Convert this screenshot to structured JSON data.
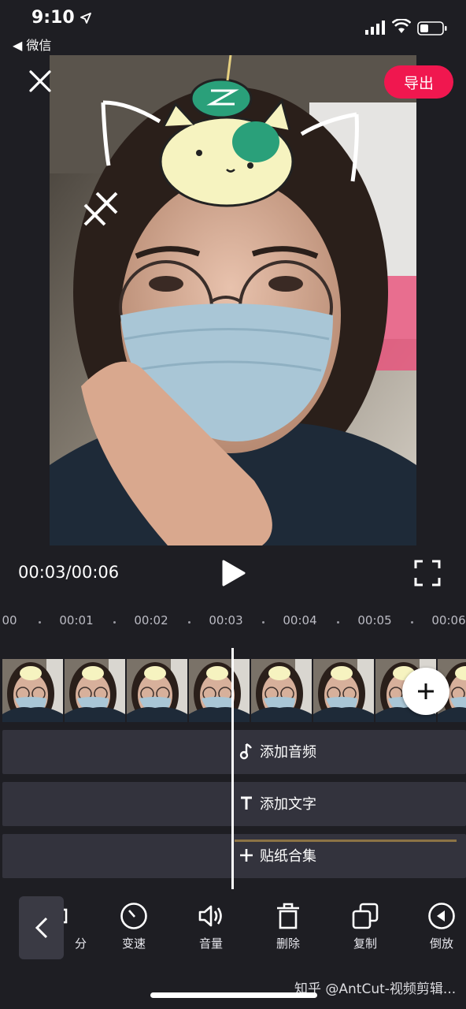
{
  "status_bar": {
    "time": "9:10",
    "back_label": "◀ 微信",
    "location_icon": "location-arrow-icon",
    "signal_icon": "signal-icon",
    "wifi_icon": "wifi-icon",
    "battery_icon": "battery-icon"
  },
  "header": {
    "close_icon": "close-icon",
    "export_label": "导出",
    "export_color": "#f0174f"
  },
  "preview": {
    "description_icon": "video-frame-selfie"
  },
  "playback": {
    "time_readout": "00:03/00:06",
    "play_icon": "play-icon",
    "fullscreen_icon": "fullscreen-icon"
  },
  "timeline": {
    "ticks": [
      "00",
      "00:01",
      "00:02",
      "00:03",
      "00:04",
      "00:05",
      "00:06"
    ],
    "audio_track_label": "添加音频",
    "text_track_label": "添加文字",
    "sticker_track_label": "贴纸合集",
    "add_clip_icon": "plus-icon"
  },
  "toolbar": {
    "back_icon": "chevron-left-icon",
    "items": [
      {
        "label": "分",
        "icon": "split-icon"
      },
      {
        "label": "变速",
        "icon": "speed-icon"
      },
      {
        "label": "音量",
        "icon": "volume-icon"
      },
      {
        "label": "删除",
        "icon": "trash-icon"
      },
      {
        "label": "复制",
        "icon": "copy-icon"
      },
      {
        "label": "倒放",
        "icon": "reverse-icon"
      }
    ]
  },
  "watermark": "知乎 @AntCut-视频剪辑...",
  "colors": {
    "background": "#1e1e23",
    "track": "#33333d",
    "accent": "#f0174f",
    "sticker_line": "#8c7345"
  }
}
